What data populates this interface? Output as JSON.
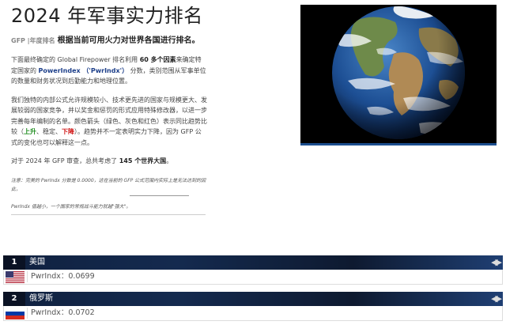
{
  "page": {
    "title": "2024 年军事实力排名",
    "subtitle_tag": "GFP |年度排名",
    "subtitle_lead": "根据当前可用火力对世界各国进行排名。"
  },
  "intro": {
    "p1_a": "下面最终确定的 Global Firepower 排名利用 ",
    "p1_b": "60 多个因素",
    "p1_c": "来确定特定国家的 ",
    "p1_link": "PowerIndex （'PwrIndx'）",
    "p1_d": " 分数，类别范围从军事单位的数量和财务状况到后勤能力和地理位置。",
    "p2_a": "我们独特的内部公式允许规模较小、技术更先进的国家与规模更大、发展较弱的国家竞争，并以奖金和惩罚的形式应用特殊修改器，以进一步完善每年编制的名单。颜色箭头（绿色、灰色和红色）表示同比趋势比较（",
    "p2_up": "上升",
    "p2_b": "、稳定、",
    "p2_down": "下降",
    "p2_c": "）。趋势并不一定表明实力下降，因为 GFP 公式的变化也可以解释这一点。",
    "p3_a": "对于 2024 年 GFP 审查，总共考虑了 ",
    "p3_b": "145 个世界大国",
    "p3_c": "。",
    "note_1": "注意：完美的 PwrIndx 分数是 0.0000，这在当前的 GFP 公式范围内实际上是无法达到的因此，",
    "note_2": "PwrIndx 值越小，一个国家的常规战斗能力就越\"强大\"。"
  },
  "rankings": [
    {
      "rank": "1",
      "country": "美国",
      "pwr": "PwrIndx：0.0699",
      "flag": "us-flag"
    },
    {
      "rank": "2",
      "country": "俄罗斯",
      "pwr": "PwrIndx：0.0702",
      "flag": "ru-flag"
    }
  ],
  "icons": {
    "trend": "left-right-arrows-icon",
    "image": "earth-globe-image"
  }
}
